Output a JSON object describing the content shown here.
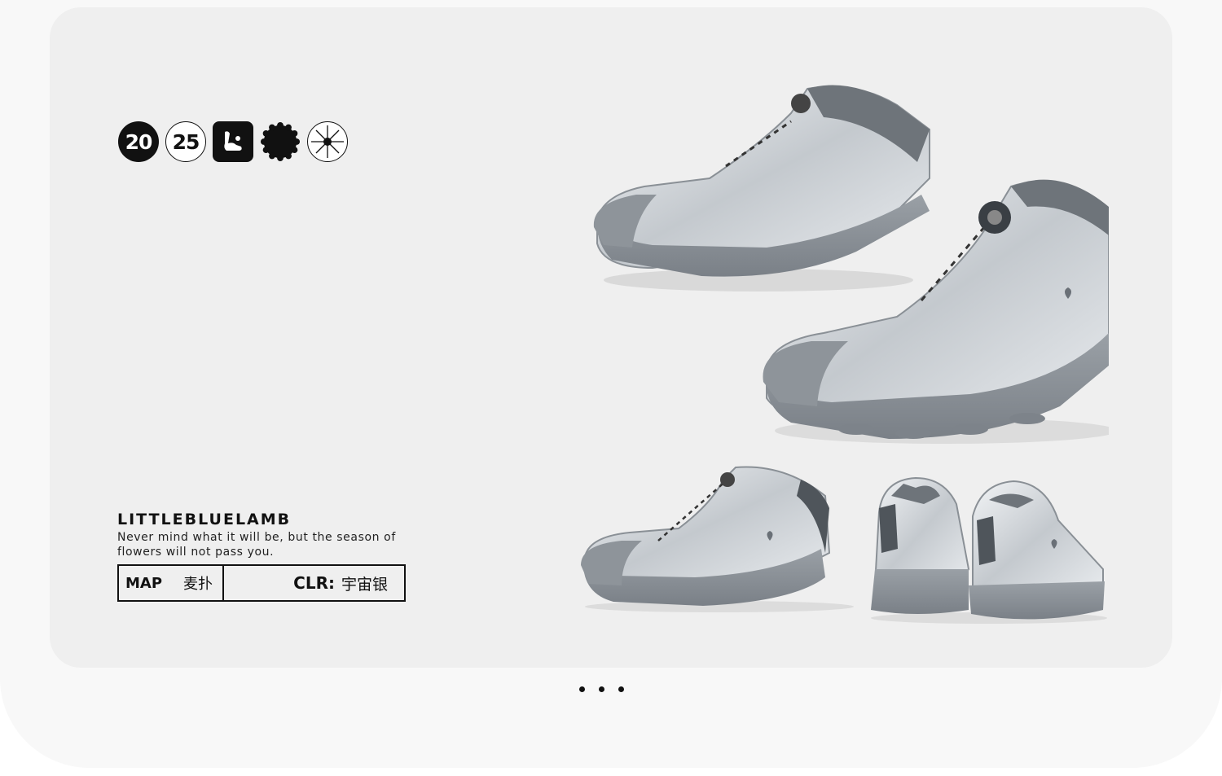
{
  "badges": {
    "year_part_1": "20",
    "year_part_2": "25",
    "icons": [
      "foot-icon",
      "scalloped-seal-icon",
      "sparkle-icon"
    ]
  },
  "brand": {
    "name": "LITTLEBLUELAMB",
    "tagline": "Never mind what it will be, but the season of flowers will not pass you."
  },
  "info": {
    "map_key": "MAP",
    "map_value": "麦扑",
    "color_key": "CLR:",
    "color_value": "宇宙银"
  },
  "carousel": {
    "dots": 3
  },
  "colors": {
    "card_background": "#efefef",
    "shoe_silver": "#c9ced3",
    "sole_grey": "#8e9399",
    "accent_dark": "#111111"
  }
}
